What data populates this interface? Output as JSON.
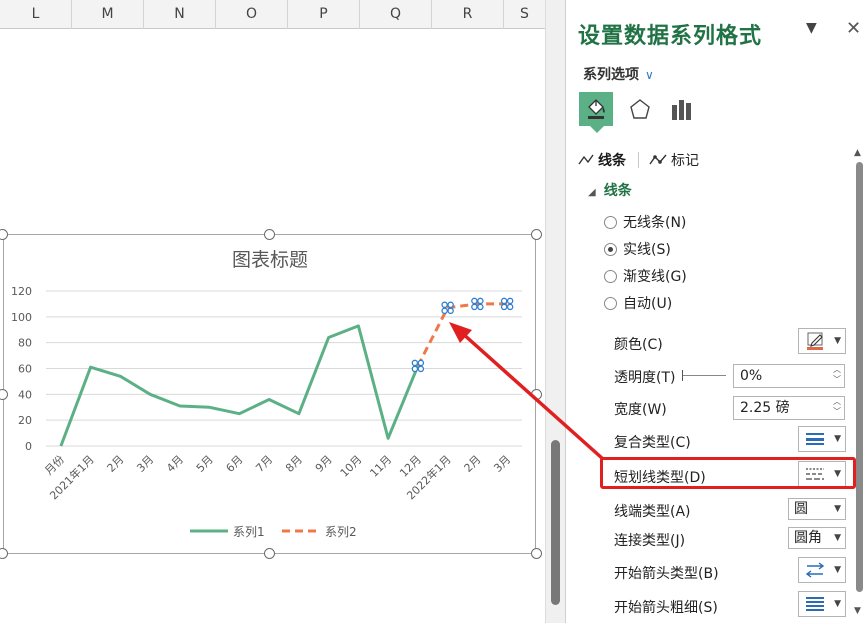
{
  "sheet": {
    "columns": [
      "L",
      "M",
      "N",
      "O",
      "P",
      "Q",
      "R",
      "S"
    ]
  },
  "chart_data": {
    "type": "line",
    "title": "图表标题",
    "categories": [
      "月份",
      "2021年1月",
      "2月",
      "3月",
      "4月",
      "5月",
      "6月",
      "7月",
      "8月",
      "9月",
      "10月",
      "11月",
      "12月",
      "2022年1月",
      "2月",
      "3月"
    ],
    "series": [
      {
        "name": "系列1",
        "color": "#5cb085",
        "values": [
          0,
          61,
          54,
          40,
          31,
          30,
          25,
          36,
          25,
          84,
          93,
          6,
          62,
          null,
          null,
          null
        ]
      },
      {
        "name": "系列2",
        "color": "#f07848",
        "dashed": true,
        "values": [
          null,
          null,
          null,
          null,
          null,
          null,
          null,
          null,
          null,
          null,
          null,
          null,
          62,
          107,
          110,
          110
        ]
      }
    ],
    "y_ticks": [
      "0",
      "20",
      "40",
      "60",
      "80",
      "100",
      "120"
    ],
    "ylim": [
      0,
      120
    ],
    "grid": true,
    "legend": "bottom"
  },
  "pane": {
    "title": "设置数据系列格式",
    "menu_icon": "chevron-down-icon",
    "close_icon": "close-icon",
    "series_options": "系列选项",
    "tabs": {
      "line": "线条",
      "marker": "标记"
    },
    "section": "线条",
    "radios": {
      "none": "无线条(N)",
      "solid": "实线(S)",
      "gradient": "渐变线(G)",
      "auto": "自动(U)"
    },
    "props": {
      "color": "颜色(C)",
      "transparency": "透明度(T)",
      "transparency_value": "0%",
      "width": "宽度(W)",
      "width_value": "2.25 磅",
      "compound": "复合类型(C)",
      "dash": "短划线类型(D)",
      "cap": "线端类型(A)",
      "cap_value": "圆",
      "join": "连接类型(J)",
      "join_value": "圆角",
      "begin_arrow": "开始箭头类型(B)",
      "begin_arrow_size": "开始箭头粗细(S)"
    },
    "accent": "#217346",
    "highlight": "#e02020"
  }
}
